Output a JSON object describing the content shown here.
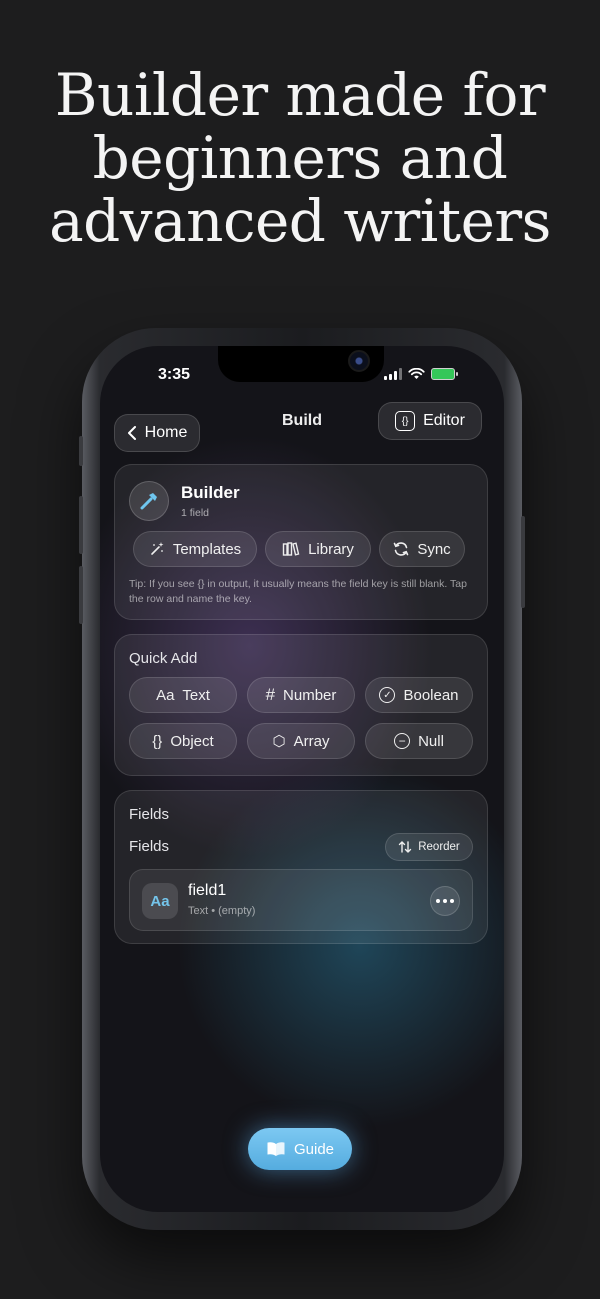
{
  "headline": [
    "Builder made for",
    "beginners and",
    "advanced writers"
  ],
  "status": {
    "time": "3:35"
  },
  "nav": {
    "back_label": "Home",
    "title": "Build",
    "editor_label": "Editor",
    "editor_icon": "{}"
  },
  "builder": {
    "title": "Builder",
    "subtitle": "1 field",
    "actions": [
      {
        "label": "Templates",
        "icon": "magic-wand-icon"
      },
      {
        "label": "Library",
        "icon": "books-icon"
      },
      {
        "label": "Sync",
        "icon": "sync-icon"
      }
    ],
    "tip": "Tip: If you see {} in output, it usually means the field key is still blank. Tap the row and name the key."
  },
  "quick_add": {
    "title": "Quick Add",
    "items": [
      {
        "label": "Text",
        "glyph": "Aa"
      },
      {
        "label": "Number",
        "glyph": "#"
      },
      {
        "label": "Boolean",
        "glyph": "✓"
      },
      {
        "label": "Object",
        "glyph": "{}"
      },
      {
        "label": "Array",
        "glyph": "⬡"
      },
      {
        "label": "Null",
        "glyph": "−"
      }
    ]
  },
  "fields": {
    "section_title": "Fields",
    "list_title": "Fields",
    "reorder_label": "Reorder",
    "rows": [
      {
        "badge": "Aa",
        "name": "field1",
        "meta": "Text • (empty)"
      }
    ]
  },
  "guide": {
    "label": "Guide"
  },
  "colors": {
    "accent": "#5fb4e4",
    "background": "#1d1d1e"
  }
}
